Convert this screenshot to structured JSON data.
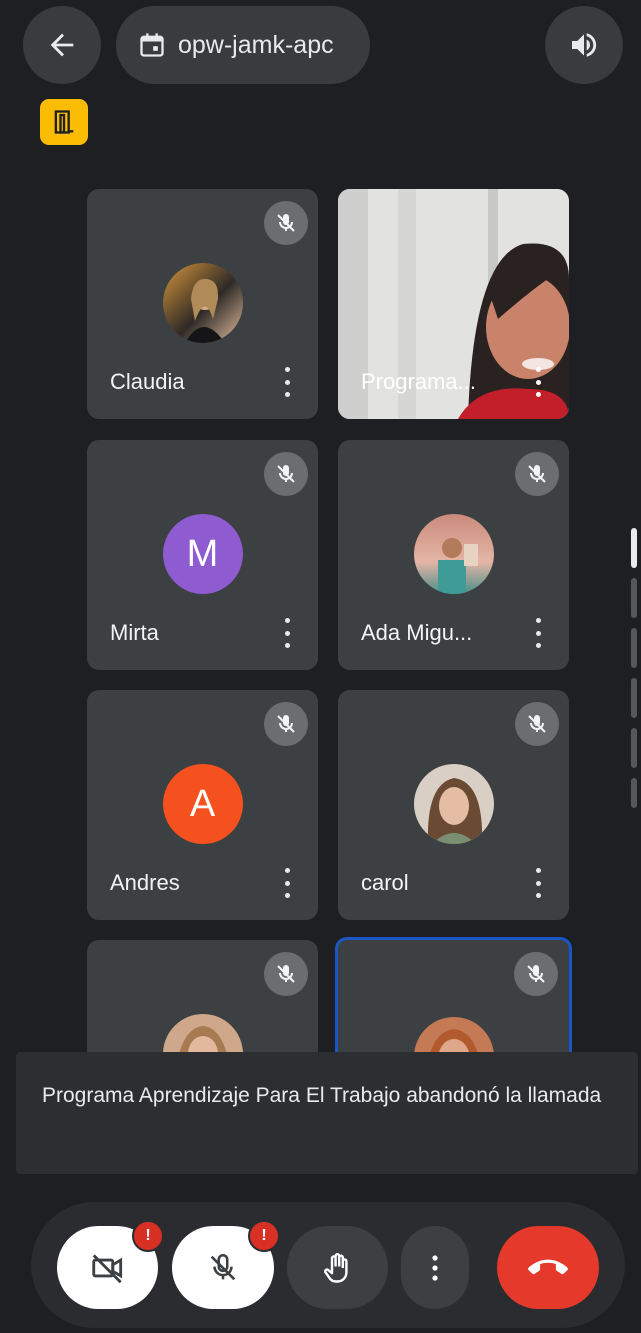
{
  "header": {
    "back_icon": "arrow-left-icon",
    "meeting_code": "opw-jamk-apc",
    "calendar_icon": "calendar-icon",
    "audio_icon": "speaker-icon",
    "badge_icon": "door-exit-icon"
  },
  "participants": [
    {
      "name": "Claudia",
      "avatar_type": "photo",
      "muted": true
    },
    {
      "name": "Programa...",
      "avatar_type": "video",
      "muted": false
    },
    {
      "name": "Mirta",
      "avatar_type": "initial",
      "initial": "M",
      "color": "#8e5bd0",
      "muted": true
    },
    {
      "name": "Ada Migu...",
      "avatar_type": "photo",
      "muted": true
    },
    {
      "name": "Andres",
      "avatar_type": "initial",
      "initial": "A",
      "color": "#f4511e",
      "muted": true
    },
    {
      "name": "carol",
      "avatar_type": "photo",
      "muted": true
    },
    {
      "name": "",
      "avatar_type": "photo",
      "muted": true
    },
    {
      "name": "",
      "avatar_type": "photo",
      "muted": true,
      "active_speaker": true
    }
  ],
  "toast": {
    "message": "Programa Aprendizaje Para El Trabajo abandonó la llamada"
  },
  "controls": {
    "camera": {
      "icon": "camera-off-icon",
      "alert": "!"
    },
    "mic": {
      "icon": "mic-off-icon",
      "alert": "!"
    },
    "raise_hand": {
      "icon": "hand-icon"
    },
    "more": {
      "icon": "more-vertical-icon"
    },
    "end_call": {
      "icon": "end-call-icon",
      "color": "#e5392b"
    }
  },
  "colors": {
    "background": "#1e1f22",
    "tile": "#3c4043",
    "active_border": "#1a56c5",
    "badge_yellow": "#fbbc04"
  }
}
